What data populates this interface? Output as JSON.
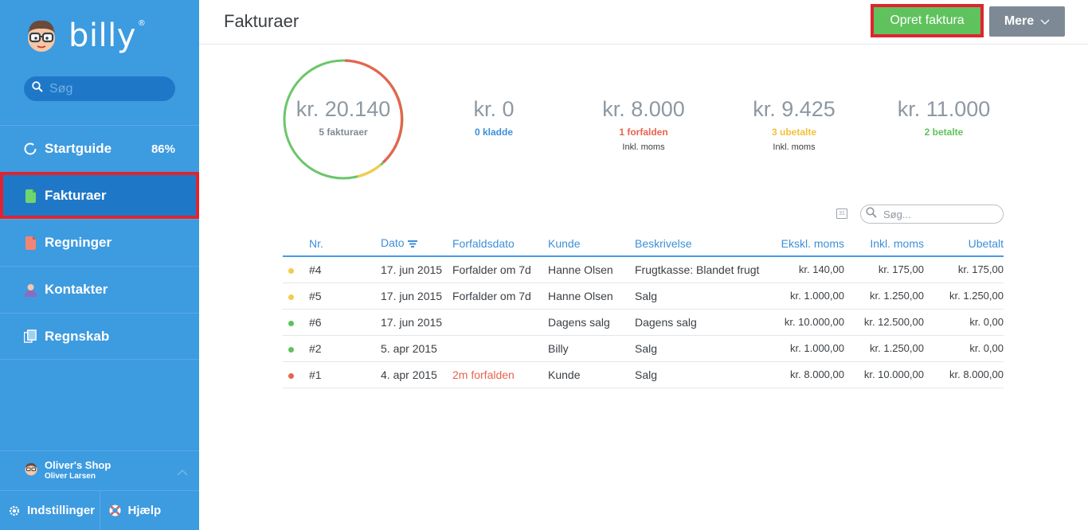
{
  "brand": {
    "name": "billy",
    "reg": "®"
  },
  "sidebar": {
    "search_placeholder": "Søg",
    "items": [
      {
        "label": "Startguide",
        "badge": "86%",
        "icon": "progress-ring-icon"
      },
      {
        "label": "Fakturaer",
        "icon": "document-green-icon"
      },
      {
        "label": "Regninger",
        "icon": "document-red-icon"
      },
      {
        "label": "Kontakter",
        "icon": "person-icon"
      },
      {
        "label": "Regnskab",
        "icon": "ledger-icon"
      }
    ],
    "account": {
      "shop": "Oliver's Shop",
      "user": "Oliver Larsen"
    },
    "bottom": {
      "settings": "Indstillinger",
      "help": "Hjælp"
    }
  },
  "header": {
    "title": "Fakturaer",
    "create_label": "Opret faktura",
    "more_label": "Mere"
  },
  "summary": {
    "total": {
      "amount": "kr. 20.140",
      "label": "5 fakturaer"
    },
    "draft": {
      "amount": "kr. 0",
      "label": "0 kladde"
    },
    "overdue": {
      "amount": "kr. 8.000",
      "label": "1 forfalden",
      "sub": "Inkl. moms"
    },
    "unpaid": {
      "amount": "kr. 9.425",
      "label": "3 ubetalte",
      "sub": "Inkl. moms"
    },
    "paid": {
      "amount": "kr. 11.000",
      "label": "2 betalte"
    }
  },
  "colors": {
    "green": "#5fc25d",
    "red": "#e8634f",
    "yellow": "#f2c94c",
    "blue": "#3d8fd8"
  },
  "table": {
    "search_placeholder": "Søg...",
    "calendar_icon_text": "31",
    "columns": [
      "Nr.",
      "Dato",
      "Forfaldsdato",
      "Kunde",
      "Beskrivelse",
      "Ekskl. moms",
      "Inkl. moms",
      "Ubetalt"
    ],
    "rows": [
      {
        "status": "yellow",
        "nr": "#4",
        "date": "17. jun 2015",
        "due": "Forfalder om 7d",
        "due_overdue": false,
        "customer": "Hanne Olsen",
        "desc": "Frugtkasse: Blandet frugt",
        "excl": "kr. 140,00",
        "incl": "kr. 175,00",
        "unpaid": "kr. 175,00"
      },
      {
        "status": "yellow",
        "nr": "#5",
        "date": "17. jun 2015",
        "due": "Forfalder om 7d",
        "due_overdue": false,
        "customer": "Hanne Olsen",
        "desc": "Salg",
        "excl": "kr. 1.000,00",
        "incl": "kr. 1.250,00",
        "unpaid": "kr. 1.250,00"
      },
      {
        "status": "green",
        "nr": "#6",
        "date": "17. jun 2015",
        "due": "",
        "due_overdue": false,
        "customer": "Dagens salg",
        "desc": "Dagens salg",
        "excl": "kr. 10.000,00",
        "incl": "kr. 12.500,00",
        "unpaid": "kr. 0,00"
      },
      {
        "status": "green",
        "nr": "#2",
        "date": "5. apr 2015",
        "due": "",
        "due_overdue": false,
        "customer": "Billy",
        "desc": "Salg",
        "excl": "kr. 1.000,00",
        "incl": "kr. 1.250,00",
        "unpaid": "kr. 0,00"
      },
      {
        "status": "red",
        "nr": "#1",
        "date": "4. apr 2015",
        "due": "2m forfalden",
        "due_overdue": true,
        "customer": "Kunde",
        "desc": "Salg",
        "excl": "kr. 8.000,00",
        "incl": "kr. 10.000,00",
        "unpaid": "kr. 8.000,00"
      }
    ]
  }
}
